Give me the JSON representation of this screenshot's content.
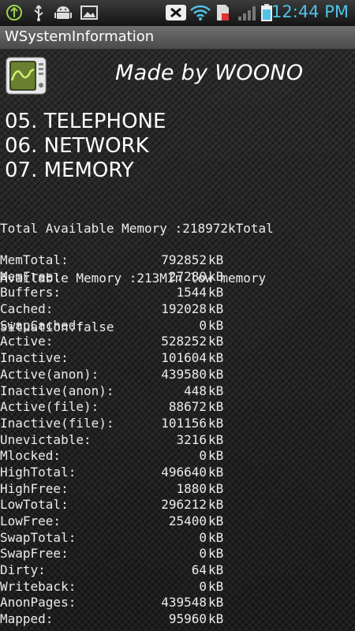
{
  "status_bar": {
    "time": "12:44 PM",
    "icons": [
      "usb-debug-icon",
      "usb-icon",
      "android-icon",
      "image-icon",
      "wifi-off-icon",
      "wifi-icon",
      "sd-card-icon",
      "signal-icon",
      "battery-icon"
    ]
  },
  "app": {
    "title": "WSystemInformation",
    "header": "Made by WOONO"
  },
  "menu": [
    {
      "label": "05. TELEPHONE"
    },
    {
      "label": "06. NETWORK"
    },
    {
      "label": "07. MEMORY"
    }
  ],
  "summary": {
    "line1": "Total Available Memory :218972kTotal",
    "line2": "Available Memory :213MIn low memory",
    "line3": "situation:false"
  },
  "meminfo": [
    {
      "key": "MemTotal:",
      "value": "792852",
      "unit": "kB"
    },
    {
      "key": "MemFree:",
      "value": "27280",
      "unit": "kB"
    },
    {
      "key": "Buffers:",
      "value": "1544",
      "unit": "kB"
    },
    {
      "key": "Cached:",
      "value": "192028",
      "unit": "kB"
    },
    {
      "key": "SwapCached:",
      "value": "0",
      "unit": "kB"
    },
    {
      "key": "Active:",
      "value": "528252",
      "unit": "kB"
    },
    {
      "key": "Inactive:",
      "value": "101604",
      "unit": "kB"
    },
    {
      "key": "Active(anon):",
      "value": "439580",
      "unit": "kB"
    },
    {
      "key": "Inactive(anon):",
      "value": "448",
      "unit": "kB"
    },
    {
      "key": "Active(file):",
      "value": "88672",
      "unit": "kB"
    },
    {
      "key": "Inactive(file):",
      "value": "101156",
      "unit": "kB"
    },
    {
      "key": "Unevictable:",
      "value": "3216",
      "unit": "kB"
    },
    {
      "key": "Mlocked:",
      "value": "0",
      "unit": "kB"
    },
    {
      "key": "HighTotal:",
      "value": "496640",
      "unit": "kB"
    },
    {
      "key": "HighFree:",
      "value": "1880",
      "unit": "kB"
    },
    {
      "key": "LowTotal:",
      "value": "296212",
      "unit": "kB"
    },
    {
      "key": "LowFree:",
      "value": "25400",
      "unit": "kB"
    },
    {
      "key": "SwapTotal:",
      "value": "0",
      "unit": "kB"
    },
    {
      "key": "SwapFree:",
      "value": "0",
      "unit": "kB"
    },
    {
      "key": "Dirty:",
      "value": "64",
      "unit": "kB"
    },
    {
      "key": "Writeback:",
      "value": "0",
      "unit": "kB"
    },
    {
      "key": "AnonPages:",
      "value": "439548",
      "unit": "kB"
    },
    {
      "key": "Mapped:",
      "value": "95960",
      "unit": "kB"
    }
  ],
  "colors": {
    "time": "#4fc3e8",
    "text": "#ececec",
    "titlebar": "#5b5b5b"
  }
}
